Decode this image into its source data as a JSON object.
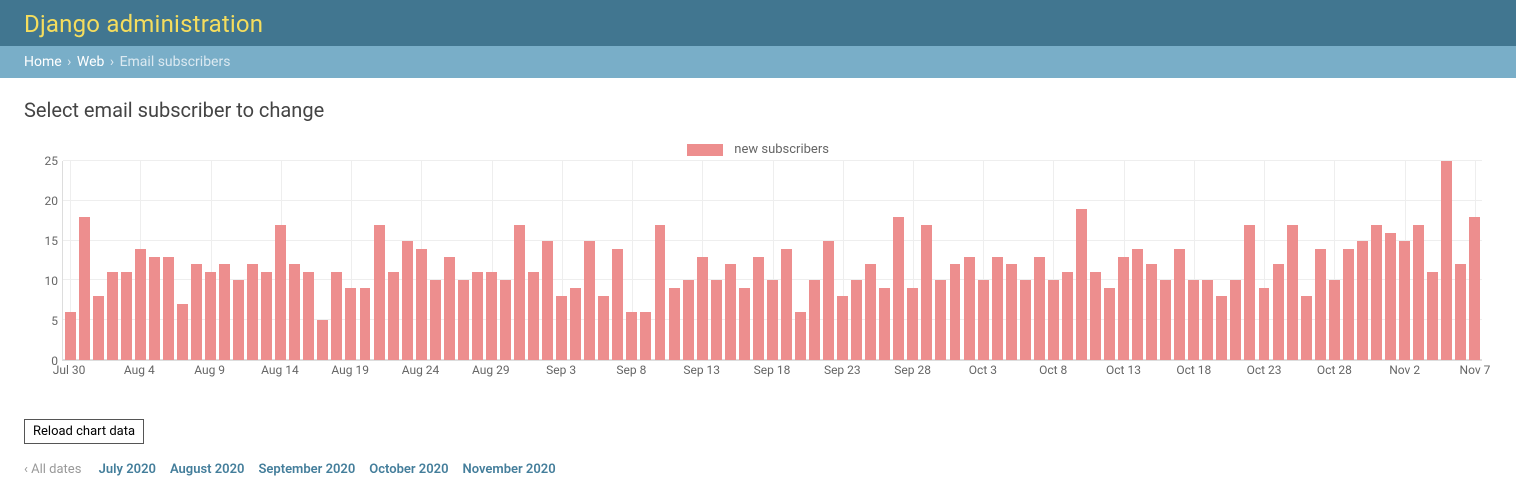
{
  "header": {
    "title": "Django administration"
  },
  "breadcrumbs": {
    "home": "Home",
    "app": "Web",
    "current": "Email subscribers"
  },
  "page": {
    "title": "Select email subscriber to change"
  },
  "legend": {
    "label": "new subscribers",
    "color": "#ed8e8e"
  },
  "actions": {
    "reload_label": "Reload chart data"
  },
  "date_filters": {
    "all_label": "‹ All dates",
    "items": [
      "July 2020",
      "August 2020",
      "September 2020",
      "October 2020",
      "November 2020"
    ]
  },
  "chart_data": {
    "type": "bar",
    "title": "",
    "xlabel": "",
    "ylabel": "",
    "ylim": [
      0,
      25
    ],
    "y_ticks": [
      0,
      5,
      10,
      15,
      20,
      25
    ],
    "x_ticks": [
      "Jul 30",
      "Aug 4",
      "Aug 9",
      "Aug 14",
      "Aug 19",
      "Aug 24",
      "Aug 29",
      "Sep 3",
      "Sep 8",
      "Sep 13",
      "Sep 18",
      "Sep 23",
      "Sep 28",
      "Oct 3",
      "Oct 8",
      "Oct 13",
      "Oct 18",
      "Oct 23",
      "Oct 28",
      "Nov 2",
      "Nov 7"
    ],
    "x_tick_interval": 5,
    "categories": [
      "Jul 30",
      "Jul 31",
      "Aug 1",
      "Aug 2",
      "Aug 3",
      "Aug 4",
      "Aug 5",
      "Aug 6",
      "Aug 7",
      "Aug 8",
      "Aug 9",
      "Aug 10",
      "Aug 11",
      "Aug 12",
      "Aug 13",
      "Aug 14",
      "Aug 15",
      "Aug 16",
      "Aug 17",
      "Aug 18",
      "Aug 19",
      "Aug 20",
      "Aug 21",
      "Aug 22",
      "Aug 23",
      "Aug 24",
      "Aug 25",
      "Aug 26",
      "Aug 27",
      "Aug 28",
      "Aug 29",
      "Aug 30",
      "Aug 31",
      "Sep 1",
      "Sep 2",
      "Sep 3",
      "Sep 4",
      "Sep 5",
      "Sep 6",
      "Sep 7",
      "Sep 8",
      "Sep 9",
      "Sep 10",
      "Sep 11",
      "Sep 12",
      "Sep 13",
      "Sep 14",
      "Sep 15",
      "Sep 16",
      "Sep 17",
      "Sep 18",
      "Sep 19",
      "Sep 20",
      "Sep 21",
      "Sep 22",
      "Sep 23",
      "Sep 24",
      "Sep 25",
      "Sep 26",
      "Sep 27",
      "Sep 28",
      "Sep 29",
      "Sep 30",
      "Oct 1",
      "Oct 2",
      "Oct 3",
      "Oct 4",
      "Oct 5",
      "Oct 6",
      "Oct 7",
      "Oct 8",
      "Oct 9",
      "Oct 10",
      "Oct 11",
      "Oct 12",
      "Oct 13",
      "Oct 14",
      "Oct 15",
      "Oct 16",
      "Oct 17",
      "Oct 18",
      "Oct 19",
      "Oct 20",
      "Oct 21",
      "Oct 22",
      "Oct 23",
      "Oct 24",
      "Oct 25",
      "Oct 26",
      "Oct 27",
      "Oct 28",
      "Oct 29",
      "Oct 30",
      "Oct 31",
      "Nov 1",
      "Nov 2",
      "Nov 3",
      "Nov 4",
      "Nov 5",
      "Nov 6",
      "Nov 7"
    ],
    "series": [
      {
        "name": "new subscribers",
        "color": "#ed8e8e",
        "values": [
          6,
          18,
          8,
          11,
          11,
          14,
          13,
          13,
          7,
          12,
          11,
          12,
          10,
          12,
          11,
          17,
          12,
          11,
          5,
          11,
          9,
          9,
          17,
          11,
          15,
          14,
          10,
          13,
          10,
          11,
          11,
          10,
          17,
          11,
          15,
          8,
          9,
          15,
          8,
          14,
          6,
          6,
          17,
          9,
          10,
          13,
          10,
          12,
          9,
          13,
          10,
          14,
          6,
          10,
          15,
          8,
          10,
          12,
          9,
          18,
          9,
          17,
          10,
          12,
          13,
          10,
          13,
          12,
          10,
          13,
          10,
          11,
          19,
          11,
          9,
          13,
          14,
          12,
          10,
          14,
          10,
          10,
          8,
          10,
          17,
          9,
          12,
          17,
          8,
          14,
          10,
          14,
          15,
          17,
          16,
          15,
          17,
          11,
          25,
          12,
          18
        ]
      }
    ]
  }
}
